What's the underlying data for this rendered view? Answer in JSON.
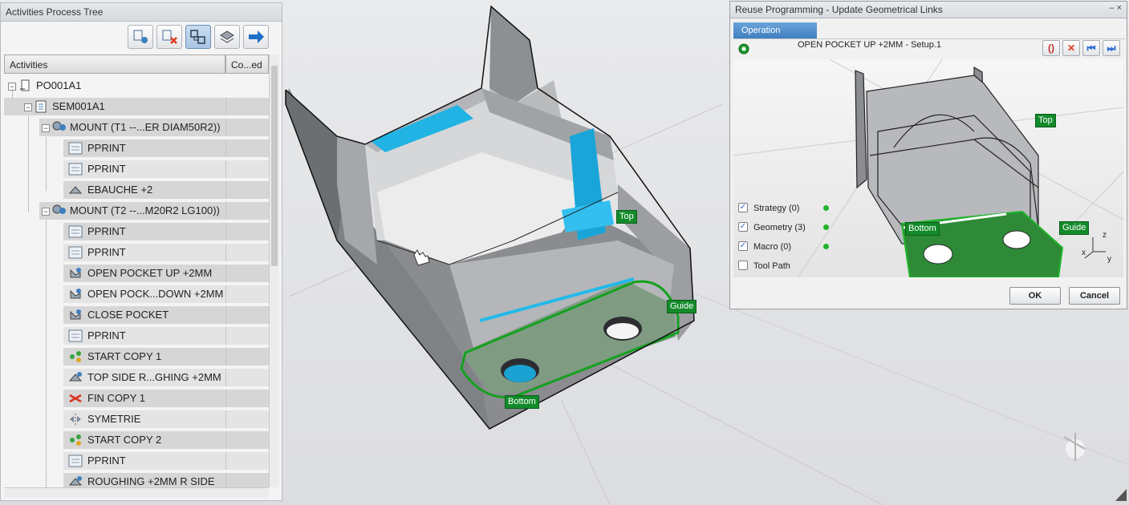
{
  "tree_panel": {
    "title": "Activities Process Tree",
    "columns": {
      "activities": "Activities",
      "coded": "Co...ed"
    },
    "toolbar": [
      "tree-add-icon",
      "tree-remove-icon",
      "tree-link-icon",
      "stack-icon",
      "arrow-right-icon"
    ],
    "rows": [
      {
        "label": "PO001A1",
        "icon": "part-operation-icon"
      },
      {
        "label": "SEM001A1",
        "icon": "program-icon"
      },
      {
        "label": "MOUNT (T1 --...ER DIAM50R2))",
        "icon": "tool-mount-icon"
      },
      {
        "label": "PPRINT",
        "icon": "pprint-icon"
      },
      {
        "label": "PPRINT",
        "icon": "pprint-icon"
      },
      {
        "label": "EBAUCHE +2",
        "icon": "roughing-icon"
      },
      {
        "label": "MOUNT (T2 --...M20R2 LG100))",
        "icon": "tool-mount-icon"
      },
      {
        "label": "PPRINT",
        "icon": "pprint-icon"
      },
      {
        "label": "PPRINT",
        "icon": "pprint-icon"
      },
      {
        "label": "OPEN POCKET UP +2MM",
        "icon": "pocket-icon"
      },
      {
        "label": "OPEN POCK...DOWN +2MM",
        "icon": "pocket-icon"
      },
      {
        "label": "CLOSE POCKET",
        "icon": "pocket-icon"
      },
      {
        "label": "PPRINT",
        "icon": "pprint-icon"
      },
      {
        "label": "START COPY 1",
        "icon": "copy-start-icon"
      },
      {
        "label": "TOP SIDE R...GHING +2MM",
        "icon": "roughing-icon"
      },
      {
        "label": "FIN COPY 1",
        "icon": "copy-end-icon"
      },
      {
        "label": "SYMETRIE",
        "icon": "symmetry-icon"
      },
      {
        "label": "START COPY 2",
        "icon": "copy-start-icon"
      },
      {
        "label": "PPRINT",
        "icon": "pprint-icon"
      },
      {
        "label": "ROUGHING +2MM R SIDE",
        "icon": "roughing-icon"
      }
    ]
  },
  "viewport": {
    "labels": {
      "top": "Top",
      "guide": "Guide",
      "bottom": "Bottom"
    }
  },
  "dialog": {
    "title": "Reuse Programming - Update Geometrical Links",
    "window_buttons": "– ×",
    "tab": "Operation",
    "operation_name": "OPEN POCKET UP +2MM - Setup.1",
    "nav_buttons": [
      "()",
      "✕",
      "⏮",
      "⏭"
    ],
    "preview_labels": {
      "top": "Top",
      "bottom": "Bottom",
      "guide": "Guide"
    },
    "axes": {
      "z": "z",
      "x": "x",
      "y": "y"
    },
    "checks": [
      {
        "label": "Strategy (0)",
        "checked": true,
        "status": true
      },
      {
        "label": "Geometry (3)",
        "checked": true,
        "status": true
      },
      {
        "label": "Macro (0)",
        "checked": true,
        "status": true
      },
      {
        "label": "Tool Path",
        "checked": false,
        "status": false
      }
    ],
    "ok": "OK",
    "cancel": "Cancel"
  },
  "colors": {
    "accent_blue": "#3f7fc0",
    "geometry_cyan": "#21b7e6",
    "link_green": "#138a2a",
    "status_green": "#21b32a"
  }
}
